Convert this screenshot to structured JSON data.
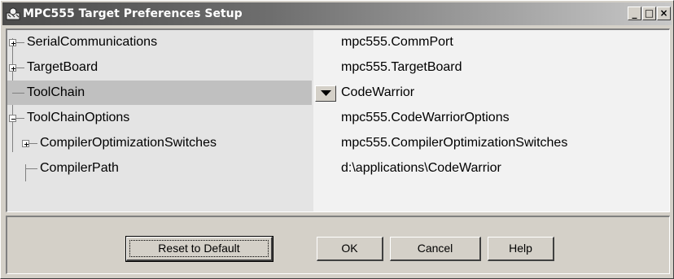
{
  "window": {
    "title": "MPC555 Target Preferences Setup",
    "controls": {
      "minimize": "_",
      "maximize": "□",
      "close": "×"
    }
  },
  "tree": {
    "rows": [
      {
        "label": "SerialCommunications",
        "value": "mpc555.CommPort",
        "expander": "plus",
        "level": 0
      },
      {
        "label": "TargetBoard",
        "value": "mpc555.TargetBoard",
        "expander": "plus",
        "level": 0
      },
      {
        "label": "ToolChain",
        "value": "CodeWarrior",
        "expander": "none",
        "level": 0,
        "selected": true,
        "editor": "dropdown"
      },
      {
        "label": "ToolChainOptions",
        "value": "mpc555.CodeWarriorOptions",
        "expander": "minus",
        "level": 0
      },
      {
        "label": "CompilerOptimizationSwitches",
        "value": "mpc555.CompilerOptimizationSwitches",
        "expander": "plus",
        "level": 1
      },
      {
        "label": "CompilerPath",
        "value": "d:\\applications\\CodeWarrior",
        "expander": "none",
        "level": 1
      }
    ]
  },
  "buttons": {
    "reset": "Reset to Default",
    "ok": "OK",
    "cancel": "Cancel",
    "help": "Help"
  },
  "colors": {
    "titlebar_start": "#4b4b4b",
    "titlebar_end": "#c8c8c8",
    "face": "#d4d0c8",
    "selected_row": "#c0c0c0"
  }
}
